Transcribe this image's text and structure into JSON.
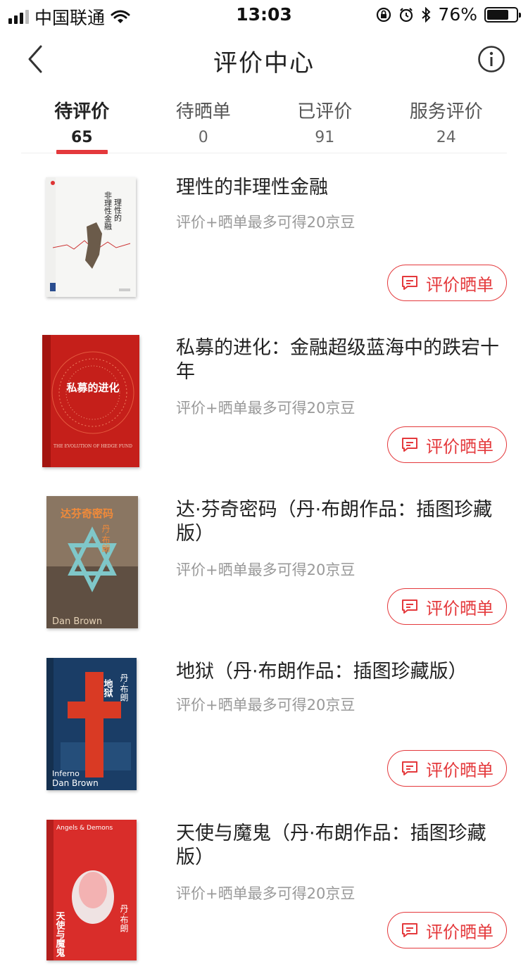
{
  "status_bar": {
    "carrier": "中国联通",
    "time": "13:03",
    "battery": "76%",
    "battery_level": 0.76,
    "icons": [
      "signal-icon",
      "wifi-icon",
      "rotation-lock-icon",
      "alarm-icon",
      "bluetooth-icon",
      "battery-icon"
    ]
  },
  "nav": {
    "title": "评价中心",
    "back_icon": "chevron-left-icon",
    "info_icon": "info-icon"
  },
  "tabs": [
    {
      "label": "待评价",
      "count": "65",
      "active": true
    },
    {
      "label": "待晒单",
      "count": "0",
      "active": false
    },
    {
      "label": "已评价",
      "count": "91",
      "active": false
    },
    {
      "label": "服务评价",
      "count": "24",
      "active": false
    }
  ],
  "accent_color": "#e4393c",
  "items": [
    {
      "title": "理性的非理性金融",
      "subtitle": "评价+晒单最多可得20京豆",
      "button": "评价晒单",
      "cover_text": [
        "非理性金融",
        "理性的"
      ]
    },
    {
      "title": "私募的进化：金融超级蓝海中的跌宕十年",
      "subtitle": "评价+晒单最多可得20京豆",
      "button": "评价晒单",
      "cover_text": [
        "私募的进化",
        "THE EVOLUTION OF HEDGE FUND"
      ]
    },
    {
      "title": "达·芬奇密码（丹·布朗作品：插图珍藏版）",
      "subtitle": "评价+晒单最多可得20京豆",
      "button": "评价晒单",
      "cover_text": [
        "达芬奇密码",
        "丹·布朗",
        "Dan Brown"
      ]
    },
    {
      "title": "地狱（丹·布朗作品：插图珍藏版）",
      "subtitle": "评价+晒单最多可得20京豆",
      "button": "评价晒单",
      "cover_text": [
        "地狱",
        "丹·布朗",
        "Inferno",
        "Dan Brown"
      ]
    },
    {
      "title": "天使与魔鬼（丹·布朗作品：插图珍藏版）",
      "subtitle": "评价+晒单最多可得20京豆",
      "button": "评价晒单",
      "cover_text": [
        "Angels & Demons",
        "天使与魔鬼",
        "丹·布朗"
      ]
    }
  ]
}
